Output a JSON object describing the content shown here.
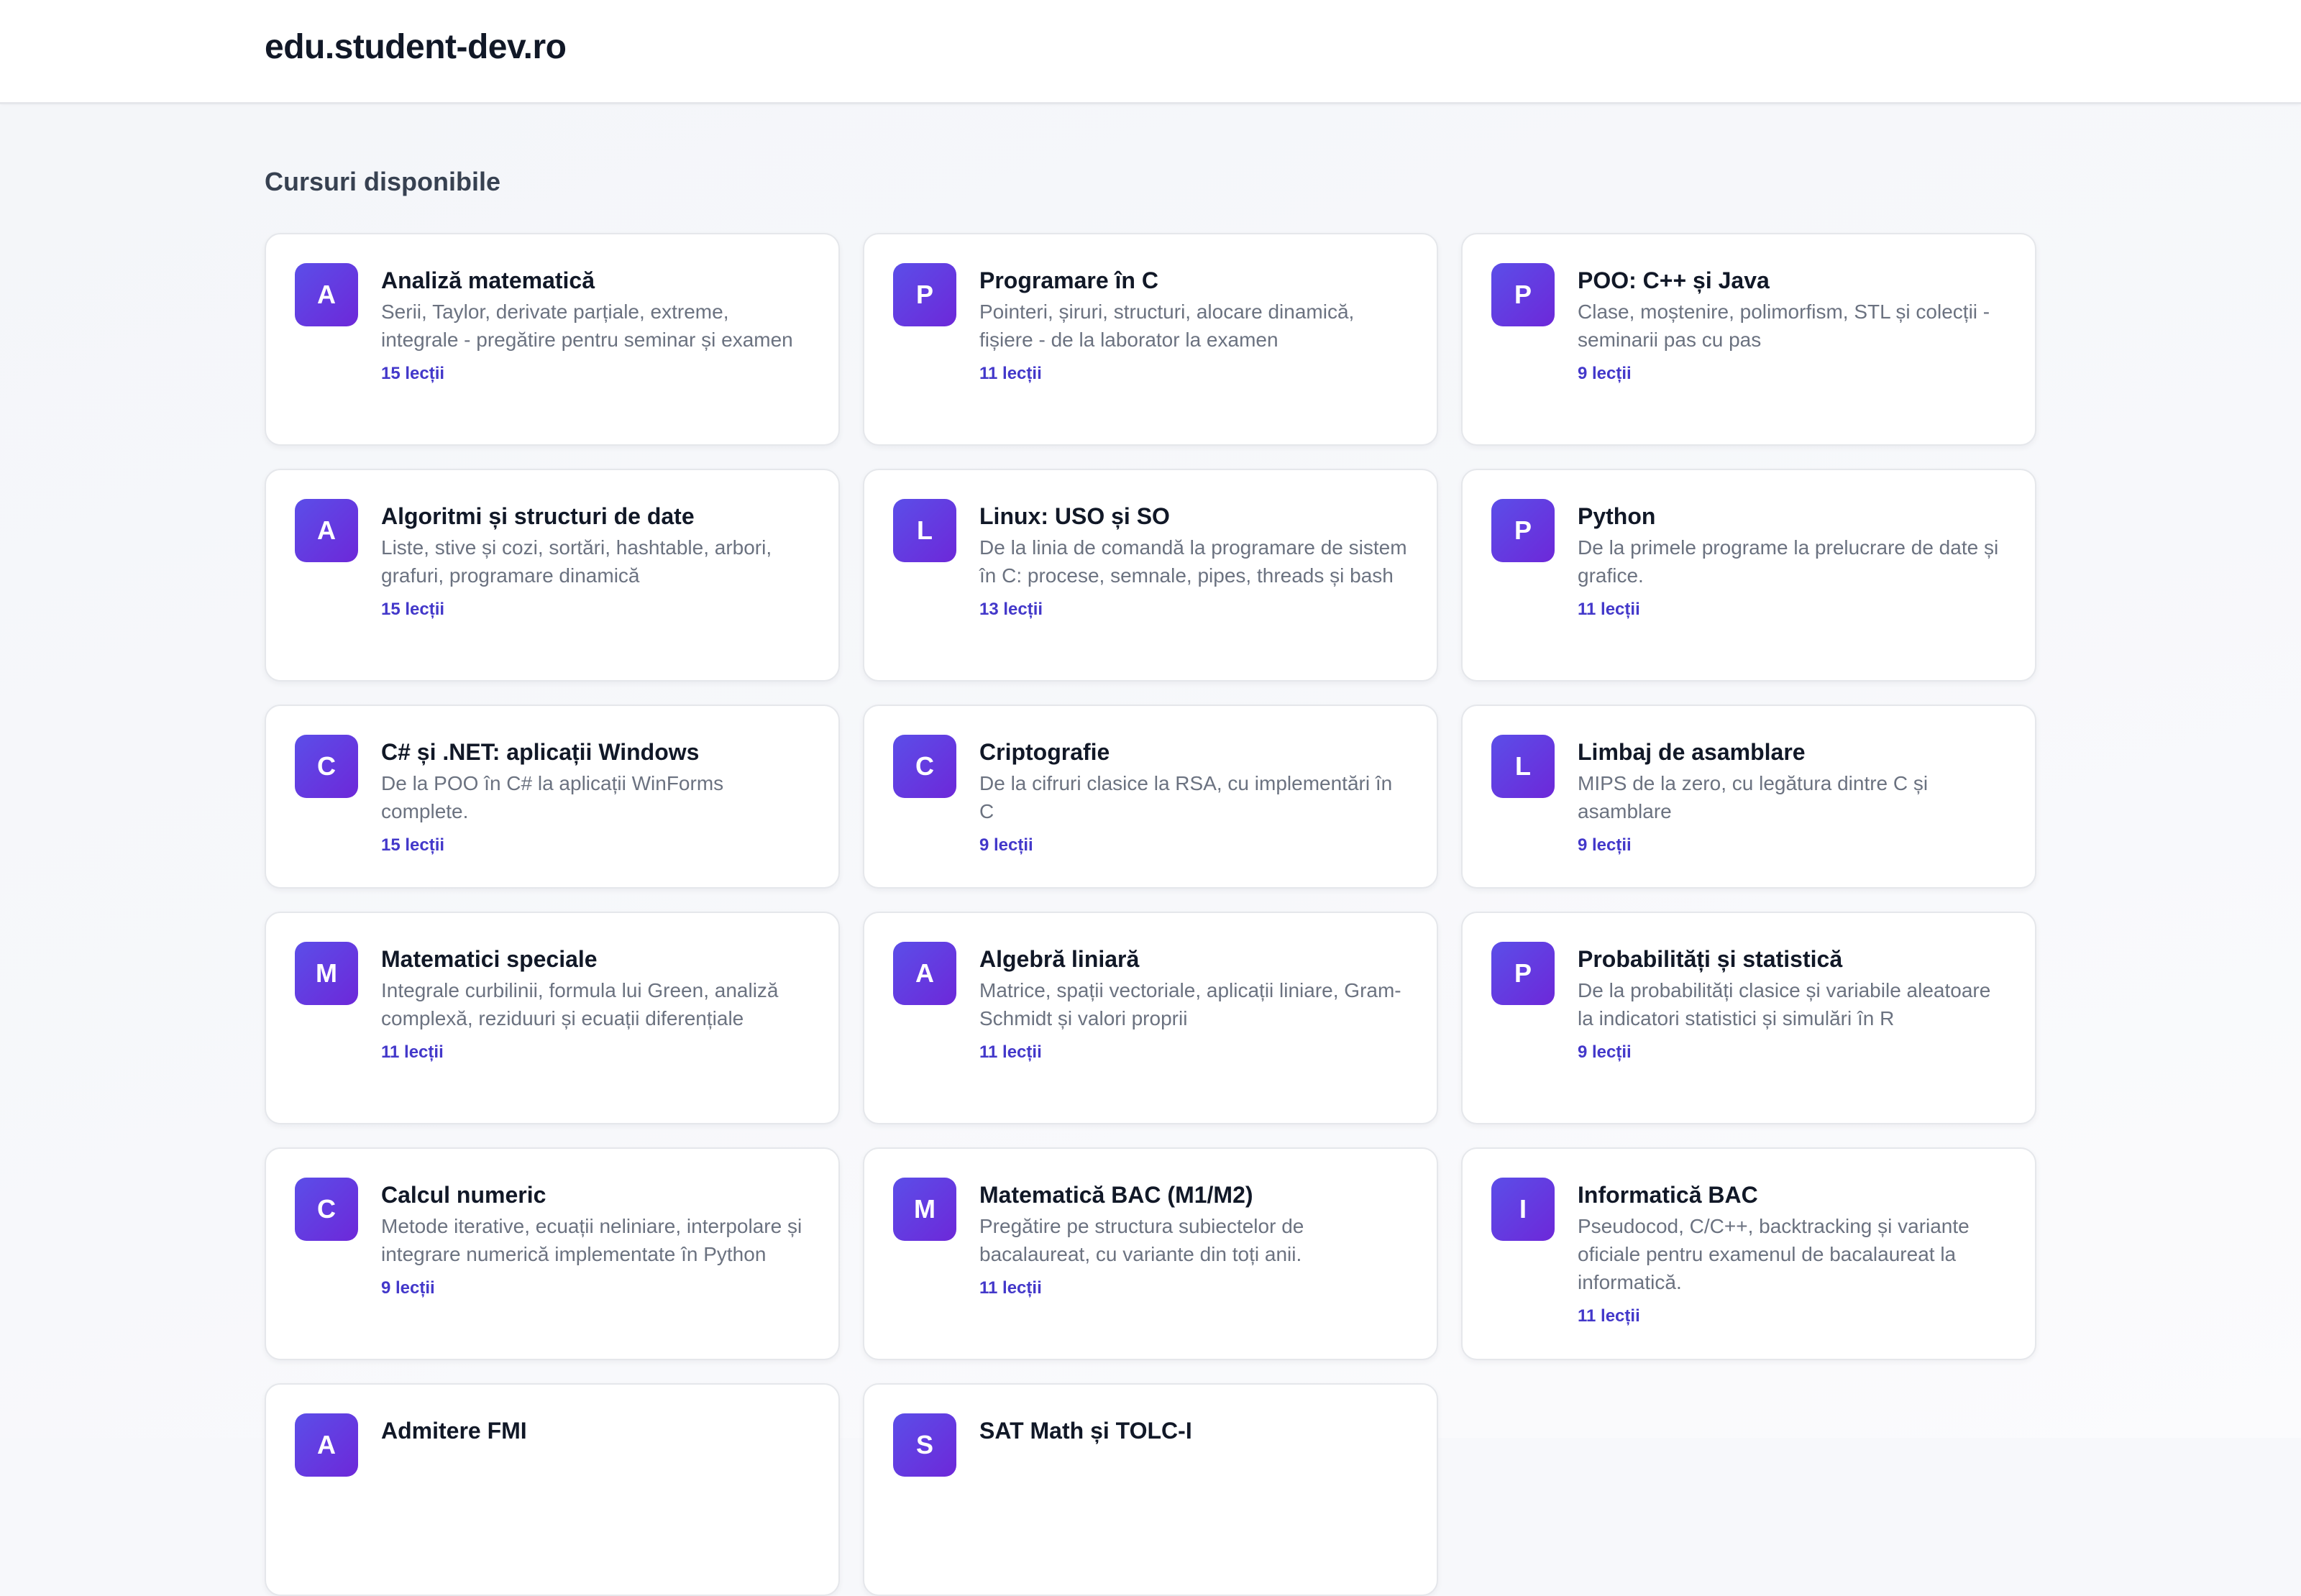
{
  "header": {
    "site_title": "edu.student-dev.ro"
  },
  "main": {
    "section_title": "Cursuri disponibile",
    "courses": [
      {
        "letter": "A",
        "title": "Analiză matematică",
        "description": "Serii, Taylor, derivate parțiale, extreme, integrale - pregătire pentru seminar și examen",
        "lessons": "15 lecții"
      },
      {
        "letter": "P",
        "title": "Programare în C",
        "description": "Pointeri, șiruri, structuri, alocare dinamică, fișiere - de la laborator la examen",
        "lessons": "11 lecții"
      },
      {
        "letter": "P",
        "title": "POO: C++ și Java",
        "description": "Clase, moștenire, polimorfism, STL și colecții - seminarii pas cu pas",
        "lessons": "9 lecții"
      },
      {
        "letter": "A",
        "title": "Algoritmi și structuri de date",
        "description": "Liste, stive și cozi, sortări, hashtable, arbori, grafuri, programare dinamică",
        "lessons": "15 lecții"
      },
      {
        "letter": "L",
        "title": "Linux: USO și SO",
        "description": "De la linia de comandă la programare de sistem în C: procese, semnale, pipes, threads și bash",
        "lessons": "13 lecții"
      },
      {
        "letter": "P",
        "title": "Python",
        "description": "De la primele programe la prelucrare de date și grafice.",
        "lessons": "11 lecții"
      },
      {
        "letter": "C",
        "title": "C# și .NET: aplicații Windows",
        "description": "De la POO în C# la aplicații WinForms complete.",
        "lessons": "15 lecții"
      },
      {
        "letter": "C",
        "title": "Criptografie",
        "description": "De la cifruri clasice la RSA, cu implementări în C",
        "lessons": "9 lecții"
      },
      {
        "letter": "L",
        "title": "Limbaj de asamblare",
        "description": "MIPS de la zero, cu legătura dintre C și asamblare",
        "lessons": "9 lecții"
      },
      {
        "letter": "M",
        "title": "Matematici speciale",
        "description": "Integrale curbilinii, formula lui Green, analiză complexă, reziduuri și ecuații diferențiale",
        "lessons": "11 lecții"
      },
      {
        "letter": "A",
        "title": "Algebră liniară",
        "description": "Matrice, spații vectoriale, aplicații liniare, Gram-Schmidt și valori proprii",
        "lessons": "11 lecții"
      },
      {
        "letter": "P",
        "title": "Probabilități și statistică",
        "description": "De la probabilități clasice și variabile aleatoare la indicatori statistici și simulări în R",
        "lessons": "9 lecții"
      },
      {
        "letter": "C",
        "title": "Calcul numeric",
        "description": "Metode iterative, ecuații neliniare, interpolare și integrare numerică implementate în Python",
        "lessons": "9 lecții"
      },
      {
        "letter": "M",
        "title": "Matematică BAC (M1/M2)",
        "description": "Pregătire pe structura subiectelor de bacalaureat, cu variante din toți anii.",
        "lessons": "11 lecții"
      },
      {
        "letter": "I",
        "title": "Informatică BAC",
        "description": "Pseudocod, C/C++, backtracking și variante oficiale pentru examenul de bacalaureat la informatică.",
        "lessons": "11 lecții"
      },
      {
        "letter": "A",
        "title": "Admitere FMI",
        "description": "",
        "lessons": ""
      },
      {
        "letter": "S",
        "title": "SAT Math și TOLC-I",
        "description": "",
        "lessons": ""
      }
    ]
  }
}
